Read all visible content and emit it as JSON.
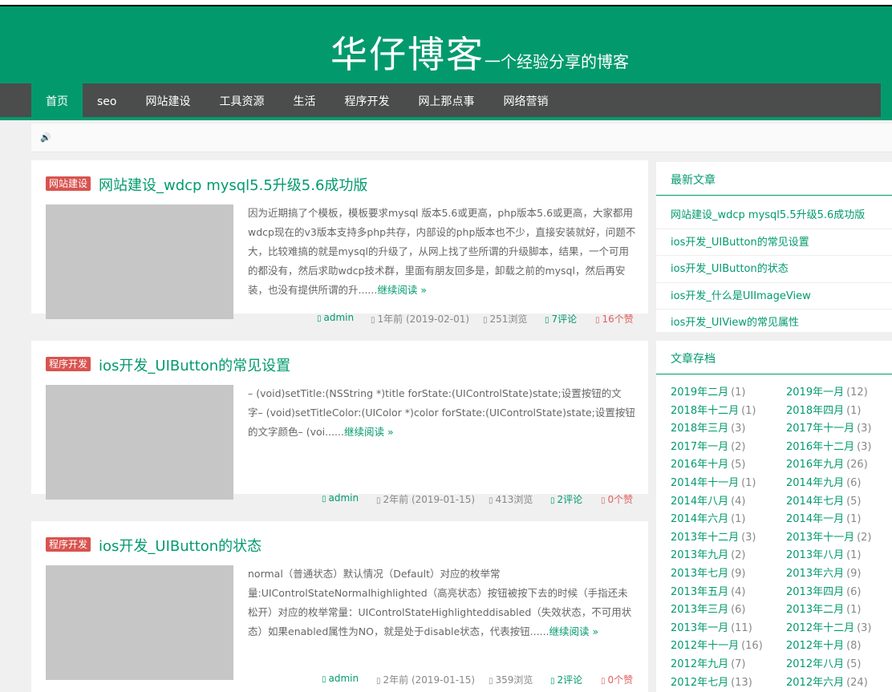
{
  "site": {
    "title": "华仔博客",
    "subtitle": "一个经验分享的博客"
  },
  "nav": {
    "items": [
      {
        "label": "首页"
      },
      {
        "label": "seo"
      },
      {
        "label": "网站建设"
      },
      {
        "label": "工具资源"
      },
      {
        "label": "生活"
      },
      {
        "label": "程序开发"
      },
      {
        "label": "网上那点事"
      },
      {
        "label": "网络营销"
      }
    ]
  },
  "notice": {
    "icon": "speaker-icon",
    "glyph": "🔊"
  },
  "posts": [
    {
      "category": "网站建设",
      "title": "网站建设_wdcp mysql5.5升级5.6成功版",
      "excerpt": "因为近期搞了个模板，模板要求mysql 版本5.6或更高，php版本5.6或更高，大家都用wdcp现在的v3版本支持多php共存，内部设的php版本也不少，直接安装就好，问题不大，比较难搞的就是mysql的升级了，从网上找了些所谓的升级脚本，结果，一个可用的都没有，然后求助wdcp技术群，里面有朋友回多是，卸载之前的mysql，然后再安装，也没有提供所谓的升......",
      "more": "继续阅读 »",
      "author": "admin",
      "date": "1年前 (2019-02-01)",
      "views": "251浏览",
      "comments": "7评论",
      "likes": "16个赞"
    },
    {
      "category": "程序开发",
      "title": "ios开发_UIButton的常见设置",
      "excerpt": "– (void)setTitle:(NSString *)title forState:(UIControlState)state;设置按钮的文字– (void)setTitleColor:(UIColor *)color forState:(UIControlState)state;设置按钮的文字颜色– (voi......",
      "more": "继续阅读 »",
      "author": "admin",
      "date": "2年前 (2019-01-15)",
      "views": "413浏览",
      "comments": "2评论",
      "likes": "0个赞"
    },
    {
      "category": "程序开发",
      "title": "ios开发_UIButton的状态",
      "excerpt": "normal（普通状态）默认情况（Default）对应的枚举常量:UIControlStateNormalhighlighted（高亮状态）按钮被按下去的时候（手指还未松开）对应的枚举常量：UIControlStateHighlighteddisabled（失效状态，不可用状态）如果enabled属性为NO，就是处于disable状态，代表按钮......",
      "more": "继续阅读 »",
      "author": "admin",
      "date": "2年前 (2019-01-15)",
      "views": "359浏览",
      "comments": "2评论",
      "likes": "0个赞"
    }
  ],
  "sidebar": {
    "recent": {
      "title": "最新文章",
      "items": [
        "网站建设_wdcp mysql5.5升级5.6成功版",
        "ios开发_UIButton的常见设置",
        "ios开发_UIButton的状态",
        "ios开发_什么是UIImageView",
        "ios开发_UIView的常见属性"
      ]
    },
    "archive": {
      "title": "文章存档",
      "items": [
        {
          "month": "2019年二月",
          "count": "(1)"
        },
        {
          "month": "2019年一月",
          "count": "(12)"
        },
        {
          "month": "2018年十二月",
          "count": "(1)"
        },
        {
          "month": "2018年四月",
          "count": "(1)"
        },
        {
          "month": "2018年三月",
          "count": "(3)"
        },
        {
          "month": "2017年十一月",
          "count": "(3)"
        },
        {
          "month": "2017年一月",
          "count": "(2)"
        },
        {
          "month": "2016年十二月",
          "count": "(3)"
        },
        {
          "month": "2016年十月",
          "count": "(5)"
        },
        {
          "month": "2016年九月",
          "count": "(26)"
        },
        {
          "month": "2014年十一月",
          "count": "(1)"
        },
        {
          "month": "2014年九月",
          "count": "(6)"
        },
        {
          "month": "2014年八月",
          "count": "(4)"
        },
        {
          "month": "2014年七月",
          "count": "(5)"
        },
        {
          "month": "2014年六月",
          "count": "(1)"
        },
        {
          "month": "2014年一月",
          "count": "(1)"
        },
        {
          "month": "2013年十二月",
          "count": "(3)"
        },
        {
          "month": "2013年十一月",
          "count": "(2)"
        },
        {
          "month": "2013年九月",
          "count": "(2)"
        },
        {
          "month": "2013年八月",
          "count": "(1)"
        },
        {
          "month": "2013年七月",
          "count": "(9)"
        },
        {
          "month": "2013年六月",
          "count": "(9)"
        },
        {
          "month": "2013年五月",
          "count": "(4)"
        },
        {
          "month": "2013年四月",
          "count": "(6)"
        },
        {
          "month": "2013年三月",
          "count": "(6)"
        },
        {
          "month": "2013年二月",
          "count": "(1)"
        },
        {
          "month": "2013年一月",
          "count": "(11)"
        },
        {
          "month": "2012年十二月",
          "count": "(3)"
        },
        {
          "month": "2012年十一月",
          "count": "(16)"
        },
        {
          "month": "2012年十月",
          "count": "(8)"
        },
        {
          "month": "2012年九月",
          "count": "(7)"
        },
        {
          "month": "2012年八月",
          "count": "(5)"
        },
        {
          "month": "2012年七月",
          "count": "(13)"
        },
        {
          "month": "2012年六月",
          "count": "(24)"
        }
      ]
    }
  },
  "colors": {
    "brand": "#029a6d",
    "nav": "#4a4d4b",
    "category": "#d9534f",
    "likes": "#e06060"
  }
}
